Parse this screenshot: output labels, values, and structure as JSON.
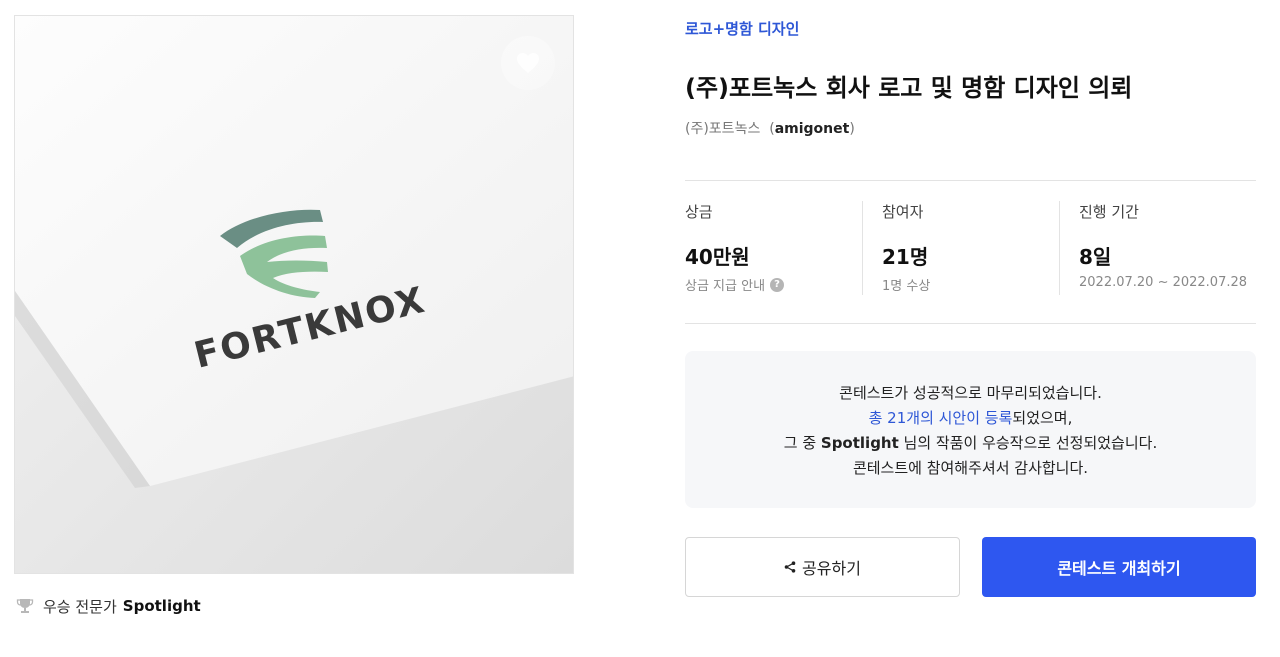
{
  "image": {
    "logo_text": "FORTKNOX",
    "favorite_icon": "heart-icon"
  },
  "winner": {
    "icon": "trophy-icon",
    "label": "우승 전문가",
    "name": "Spotlight"
  },
  "contest": {
    "category": "로고+명함 디자인",
    "title": "(주)포트녹스 회사 로고 및 명함 디자인 의뢰",
    "host_name": "(주)포트녹스",
    "host_id": "amigonet"
  },
  "stats": {
    "prize": {
      "label": "상금",
      "value": "40만원",
      "sub": "상금 지급 안내",
      "sub_icon": "help-icon"
    },
    "participants": {
      "label": "참여자",
      "value": "21명",
      "sub": "1명 수상"
    },
    "period": {
      "label": "진행 기간",
      "value": "8일",
      "sub": "2022.07.20 ~ 2022.07.28"
    }
  },
  "notice": {
    "line1": "콘테스트가 성공적으로 마무리되었습니다.",
    "line2_link": "총 21개의 시안이 등록",
    "line2_rest": "되었으며,",
    "line3_pre": "그 중 ",
    "line3_name": "Spotlight",
    "line3_post": " 님의 작품이 우승작으로 선정되었습니다.",
    "line4": "콘테스트에 참여해주셔서 감사합니다."
  },
  "actions": {
    "share_label": "공유하기",
    "share_icon": "share-icon",
    "host_label": "콘테스트 개최하기"
  },
  "colors": {
    "accent": "#2e57f0",
    "link": "#2e57d6",
    "logo_dark": "#6a8e84",
    "logo_light": "#8ec29a",
    "logo_text": "#3a3a3a"
  }
}
